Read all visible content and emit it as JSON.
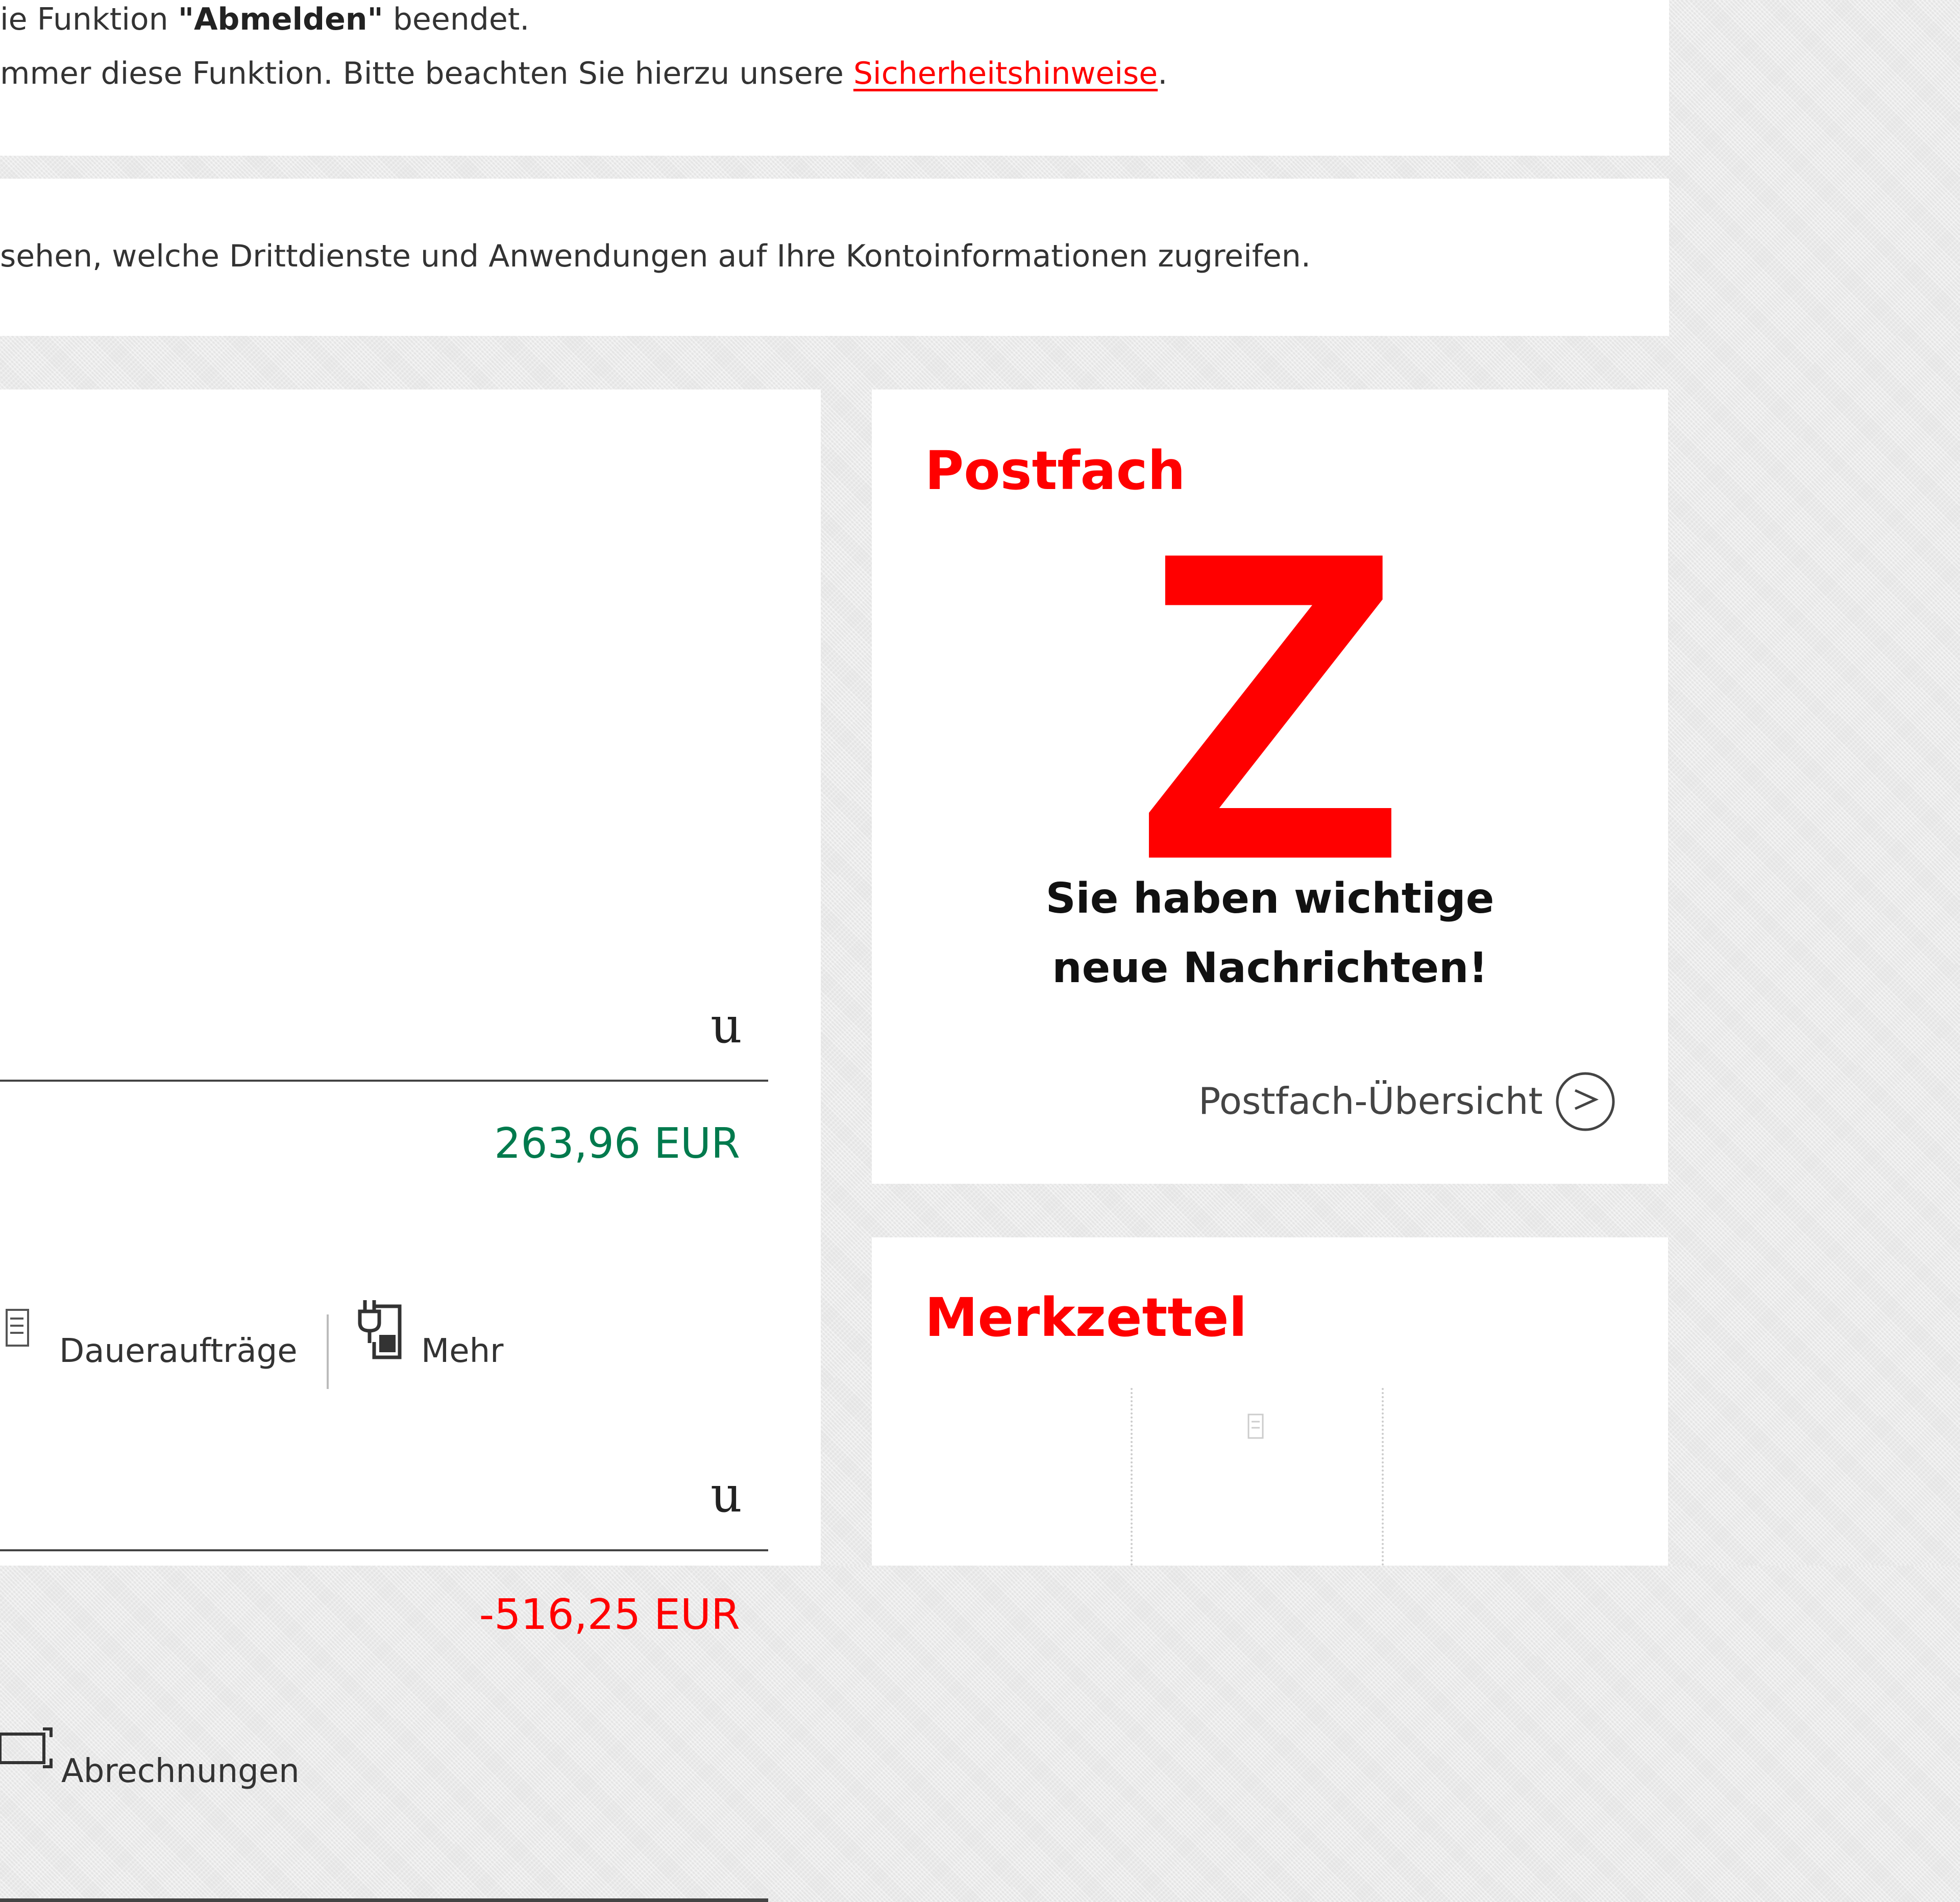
{
  "notice": {
    "line1_prefix": "ie Funktion ",
    "line1_bold": "\"Abmelden\"",
    "line1_suffix": " beendet.",
    "line2_prefix": "mmer diese Funktion. Bitte beachten Sie hierzu unsere ",
    "line2_link": "Sicherheitshinweise",
    "line2_suffix": "."
  },
  "third_party": {
    "text": "sehen, welche Drittdienste und Anwendungen auf Ihre Kontoinformationen zugreifen."
  },
  "accounts": {
    "account1": {
      "collapse_glyph": "u",
      "balance": "263,96 EUR",
      "balance_color": "#007a4d",
      "actions": [
        {
          "label": "Daueraufträge",
          "icon": "standing-order-icon"
        },
        {
          "label": "Mehr",
          "icon": "more-icon"
        }
      ]
    },
    "account2": {
      "collapse_glyph": "u",
      "balance": "-516,25 EUR",
      "balance_color": "#ff0000",
      "actions": [
        {
          "label": "Abrechnungen",
          "icon": "statements-icon"
        }
      ]
    }
  },
  "postfach": {
    "title": "Postfach",
    "big_letter": "Z",
    "message": "Sie haben wichtige neue Nachrichten!",
    "overview_link": "Postfach-Übersicht",
    "accent": "#ff0000"
  },
  "merkzettel": {
    "title": "Merkzettel"
  }
}
